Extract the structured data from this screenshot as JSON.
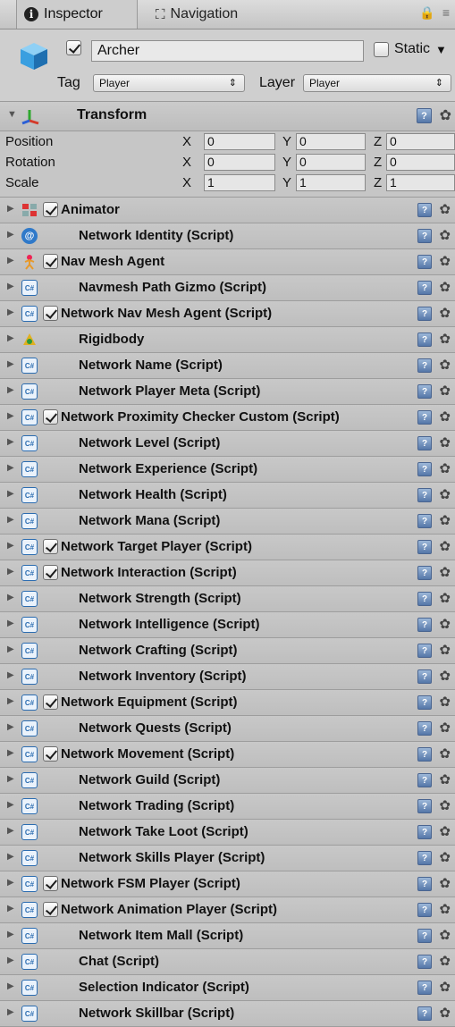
{
  "tabs": {
    "inspector": "Inspector",
    "navigation": "Navigation",
    "info_glyph": "i"
  },
  "header": {
    "object_name": "Archer",
    "active_checked": true,
    "static_label": "Static",
    "tag_label": "Tag",
    "tag_value": "Player",
    "layer_label": "Layer",
    "layer_value": "Player"
  },
  "transform": {
    "title": "Transform",
    "rows": [
      {
        "label": "Position",
        "x": "0",
        "y": "0",
        "z": "0"
      },
      {
        "label": "Rotation",
        "x": "0",
        "y": "0",
        "z": "0"
      },
      {
        "label": "Scale",
        "x": "1",
        "y": "1",
        "z": "1"
      }
    ],
    "axis_labels": {
      "x": "X",
      "y": "Y",
      "z": "Z"
    }
  },
  "components": [
    {
      "name": "Animator",
      "icon": "animator-icon",
      "checkbox": true
    },
    {
      "name": "Network Identity (Script)",
      "icon": "network-identity-icon",
      "checkbox": false
    },
    {
      "name": "Nav Mesh Agent",
      "icon": "nav-agent-icon",
      "checkbox": true
    },
    {
      "name": "Navmesh Path Gizmo (Script)",
      "icon": "script-icon",
      "checkbox": false
    },
    {
      "name": "Network Nav Mesh Agent (Script)",
      "icon": "script-icon",
      "checkbox": true
    },
    {
      "name": "Rigidbody",
      "icon": "rigidbody-icon",
      "checkbox": false
    },
    {
      "name": "Network Name (Script)",
      "icon": "script-icon",
      "checkbox": false
    },
    {
      "name": "Network Player Meta (Script)",
      "icon": "script-icon",
      "checkbox": false
    },
    {
      "name": "Network Proximity Checker Custom (Script)",
      "icon": "script-icon",
      "checkbox": true
    },
    {
      "name": "Network Level (Script)",
      "icon": "script-icon",
      "checkbox": false
    },
    {
      "name": "Network Experience (Script)",
      "icon": "script-icon",
      "checkbox": false
    },
    {
      "name": "Network Health (Script)",
      "icon": "script-icon",
      "checkbox": false
    },
    {
      "name": "Network Mana (Script)",
      "icon": "script-icon",
      "checkbox": false
    },
    {
      "name": "Network Target Player (Script)",
      "icon": "script-icon",
      "checkbox": true
    },
    {
      "name": "Network Interaction (Script)",
      "icon": "script-icon",
      "checkbox": true
    },
    {
      "name": "Network Strength (Script)",
      "icon": "script-icon",
      "checkbox": false
    },
    {
      "name": "Network Intelligence (Script)",
      "icon": "script-icon",
      "checkbox": false
    },
    {
      "name": "Network Crafting (Script)",
      "icon": "script-icon",
      "checkbox": false
    },
    {
      "name": "Network Inventory (Script)",
      "icon": "script-icon",
      "checkbox": false
    },
    {
      "name": "Network Equipment (Script)",
      "icon": "script-icon",
      "checkbox": true
    },
    {
      "name": "Network Quests (Script)",
      "icon": "script-icon",
      "checkbox": false
    },
    {
      "name": "Network Movement (Script)",
      "icon": "script-icon",
      "checkbox": true
    },
    {
      "name": "Network Guild (Script)",
      "icon": "script-icon",
      "checkbox": false
    },
    {
      "name": "Network Trading (Script)",
      "icon": "script-icon",
      "checkbox": false
    },
    {
      "name": "Network Take Loot (Script)",
      "icon": "script-icon",
      "checkbox": false
    },
    {
      "name": "Network Skills Player (Script)",
      "icon": "script-icon",
      "checkbox": false
    },
    {
      "name": "Network FSM Player (Script)",
      "icon": "script-icon",
      "checkbox": true
    },
    {
      "name": "Network Animation Player (Script)",
      "icon": "script-icon",
      "checkbox": true
    },
    {
      "name": "Network Item Mall (Script)",
      "icon": "script-icon",
      "checkbox": false
    },
    {
      "name": "Chat (Script)",
      "icon": "script-icon",
      "checkbox": false
    },
    {
      "name": "Selection Indicator (Script)",
      "icon": "script-icon",
      "checkbox": false
    },
    {
      "name": "Network Skillbar (Script)",
      "icon": "script-icon",
      "checkbox": false
    }
  ],
  "colors": {
    "panel": "#c2c2c2",
    "script_blue": "#2b6cb0",
    "help_blue": "#5577a8"
  }
}
